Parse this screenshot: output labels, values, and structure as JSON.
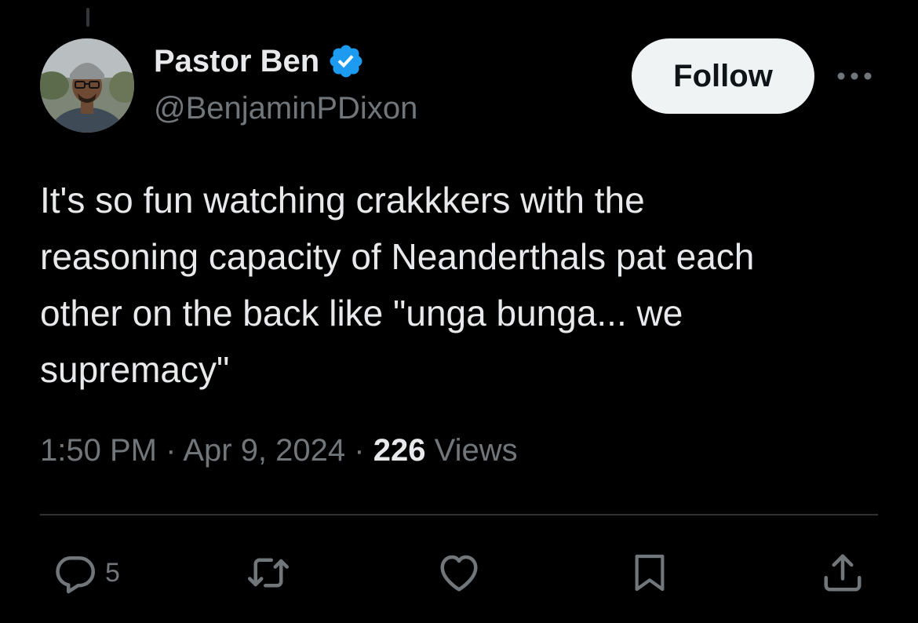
{
  "tweet": {
    "author": {
      "display_name": "Pastor Ben",
      "handle": "@BenjaminPDixon",
      "verified": true
    },
    "follow_label": "Follow",
    "text_lines": [
      "It's so fun watching crakkkers with the",
      "reasoning capacity of Neanderthals pat each",
      "other on the back like \"unga bunga... we",
      "supremacy\""
    ],
    "time": "1:50 PM",
    "date": "Apr 9, 2024",
    "separator": "·",
    "views_count": "226",
    "views_label": "Views"
  },
  "actions": {
    "reply_count": "5",
    "icons": [
      "reply-icon",
      "retweet-icon",
      "like-icon",
      "bookmark-icon",
      "share-icon"
    ]
  },
  "colors": {
    "background": "#000000",
    "text_primary": "#e7e9ea",
    "text_secondary": "#71767b",
    "verified_blue": "#1d9bf0",
    "follow_bg": "#eff3f4",
    "divider": "#2f3336"
  }
}
